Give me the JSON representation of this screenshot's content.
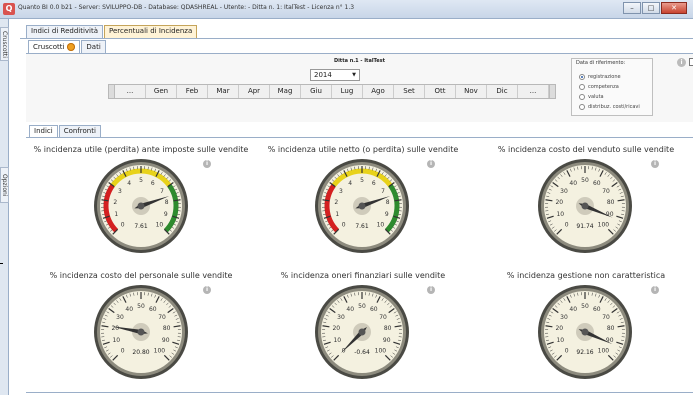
{
  "window": {
    "app_icon_letter": "Q",
    "title": "Quanto BI 0.0 b21 - Server: SVILUPPO-DB - Database: QDASHREAL - Utente: - Ditta n. 1: ItalTest - Licenza n° 1.3"
  },
  "side_tabs": {
    "cruscotti": "Cruscotti",
    "opzioni": "Opzioni"
  },
  "top_tabs": [
    {
      "label": "Indici di Redditività",
      "active": false
    },
    {
      "label": "Percentuali di Incidenza",
      "active": true
    }
  ],
  "sub_tabs": [
    {
      "label": "Cruscotti",
      "active": true
    },
    {
      "label": "Dati",
      "active": false
    }
  ],
  "header": {
    "company": "Ditta n.1 - ItalTest",
    "year": "2014",
    "months": [
      "...",
      "Gen",
      "Feb",
      "Mar",
      "Apr",
      "Mag",
      "Giu",
      "Lug",
      "Ago",
      "Set",
      "Ott",
      "Nov",
      "Dic",
      "..."
    ]
  },
  "reference": {
    "title": "Data di riferimento:",
    "options": [
      {
        "label": "registrazione",
        "selected": true
      },
      {
        "label": "competenza",
        "selected": false
      },
      {
        "label": "valuta",
        "selected": false
      },
      {
        "label": "distribuz. costi/ricavi",
        "selected": false
      }
    ]
  },
  "inner_tabs": [
    {
      "label": "Indici",
      "active": true
    },
    {
      "label": "Confronti",
      "active": false
    }
  ],
  "gauges": [
    {
      "title": "% incidenza utile (perdita) ante imposte sulle vendite",
      "value": 7.61,
      "display": "7.61",
      "min": 0,
      "max": 10,
      "ticks": [
        0,
        1,
        2,
        3,
        4,
        5,
        6,
        7,
        8,
        9,
        10
      ],
      "colored": true
    },
    {
      "title": "% incidenza utile netto (o perdita) sulle vendite",
      "value": 7.61,
      "display": "7.61",
      "min": 0,
      "max": 10,
      "ticks": [
        0,
        1,
        2,
        3,
        4,
        5,
        6,
        7,
        8,
        9,
        10
      ],
      "colored": true
    },
    {
      "title": "% incidenza costo del venduto sulle vendite",
      "value": 91.74,
      "display": "91.74",
      "min": 0,
      "max": 100,
      "ticks": [
        0,
        10,
        20,
        30,
        40,
        50,
        60,
        70,
        80,
        90,
        100
      ],
      "colored": false
    },
    {
      "title": "% incidenza costo del personale sulle vendite",
      "value": 20.8,
      "display": "20.80",
      "min": 0,
      "max": 100,
      "ticks": [
        0,
        10,
        20,
        30,
        40,
        50,
        60,
        70,
        80,
        90,
        100
      ],
      "colored": false
    },
    {
      "title": "% incidenza oneri finanziari sulle vendite",
      "value": -0.64,
      "display": "-0.64",
      "min": 0,
      "max": 100,
      "ticks": [
        0,
        10,
        20,
        30,
        40,
        50,
        60,
        70,
        80,
        90,
        100
      ],
      "colored": false
    },
    {
      "title": "% incidenza gestione non caratteristica",
      "value": 92.16,
      "display": "92.16",
      "min": 0,
      "max": 100,
      "ticks": [
        0,
        10,
        20,
        30,
        40,
        50,
        60,
        70,
        80,
        90,
        100
      ],
      "colored": false
    }
  ],
  "icons": {
    "info": "i",
    "gear": "gear-icon"
  },
  "colors": {
    "zone_red": "#d42020",
    "zone_yellow": "#e8d21a",
    "zone_green": "#2e8b2e",
    "needle": "#333333",
    "face": "#f4f1e0",
    "rim": "#4a4a44"
  }
}
